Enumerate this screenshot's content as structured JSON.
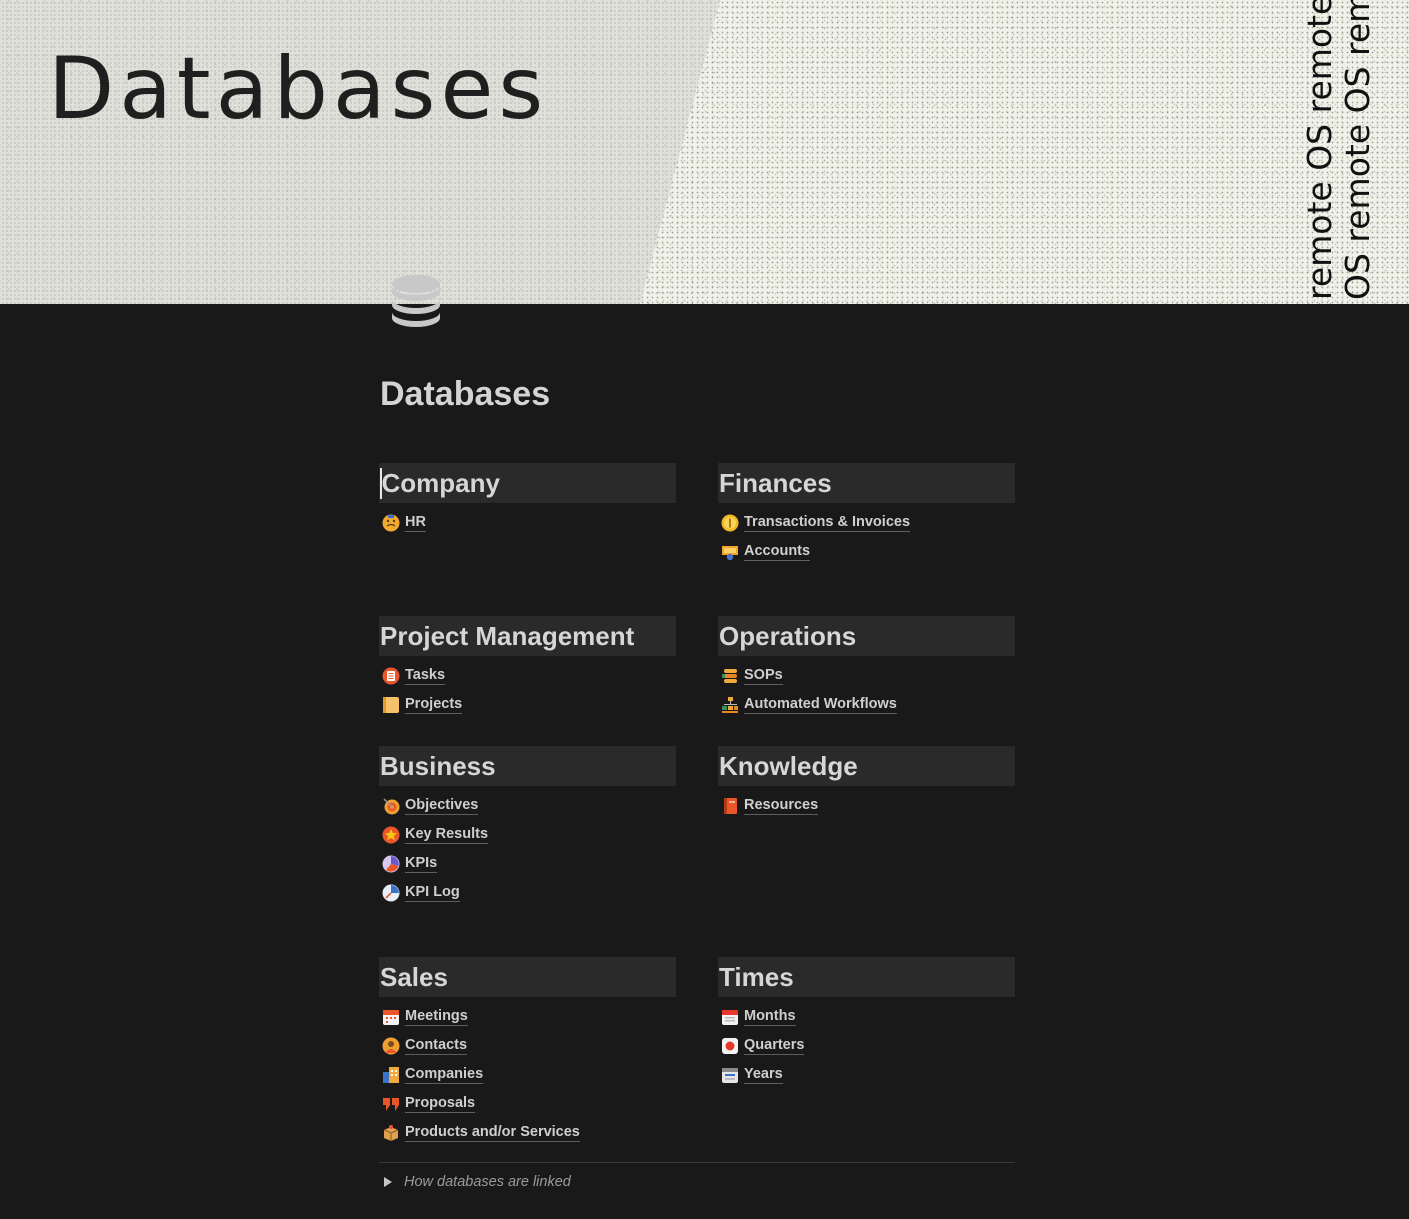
{
  "cover": {
    "title": "Databases",
    "vertical_text_line1": "remote OS remote OS remote OS",
    "vertical_text_line2": "OS remote OS remote OS remote"
  },
  "page": {
    "icon": "database-icon",
    "title": "Databases"
  },
  "sections": [
    {
      "title": "Company",
      "items": [
        {
          "icon": "hr-emoji-icon",
          "label": "HR"
        }
      ]
    },
    {
      "title": "Finances",
      "items": [
        {
          "icon": "coin-emoji-icon",
          "label": "Transactions & Invoices"
        },
        {
          "icon": "bank-emoji-icon",
          "label": "Accounts"
        }
      ]
    },
    {
      "title": "Project Management",
      "items": [
        {
          "icon": "tasks-emoji-icon",
          "label": "Tasks"
        },
        {
          "icon": "notebook-emoji-icon",
          "label": "Projects"
        }
      ]
    },
    {
      "title": "Operations",
      "items": [
        {
          "icon": "stack-emoji-icon",
          "label": "SOPs"
        },
        {
          "icon": "workflow-emoji-icon",
          "label": "Automated Workflows"
        }
      ]
    },
    {
      "title": "Business",
      "items": [
        {
          "icon": "target-emoji-icon",
          "label": "Objectives"
        },
        {
          "icon": "star-emoji-icon",
          "label": "Key Results"
        },
        {
          "icon": "chart-emoji-icon",
          "label": "KPIs"
        },
        {
          "icon": "gauge-emoji-icon",
          "label": "KPI Log"
        }
      ]
    },
    {
      "title": "Knowledge",
      "items": [
        {
          "icon": "book-emoji-icon",
          "label": "Resources"
        }
      ]
    },
    {
      "title": "Sales",
      "items": [
        {
          "icon": "calendar-emoji-icon",
          "label": "Meetings"
        },
        {
          "icon": "contacts-emoji-icon",
          "label": "Contacts"
        },
        {
          "icon": "building-emoji-icon",
          "label": "Companies"
        },
        {
          "icon": "quote-emoji-icon",
          "label": "Proposals"
        },
        {
          "icon": "box-emoji-icon",
          "label": "Products and/or Services"
        }
      ]
    },
    {
      "title": "Times",
      "items": [
        {
          "icon": "calendar-month-emoji-icon",
          "label": "Months"
        },
        {
          "icon": "record-emoji-icon",
          "label": "Quarters"
        },
        {
          "icon": "calendar-year-emoji-icon",
          "label": "Years"
        }
      ]
    }
  ],
  "toggle": {
    "label": "How databases are linked"
  },
  "colors": {
    "background": "#191919",
    "header_bg": "#2a2a2a",
    "text": "#d4d4d4",
    "cover_light": "#f1f1ea",
    "cover_panel": "#dfe0da"
  }
}
